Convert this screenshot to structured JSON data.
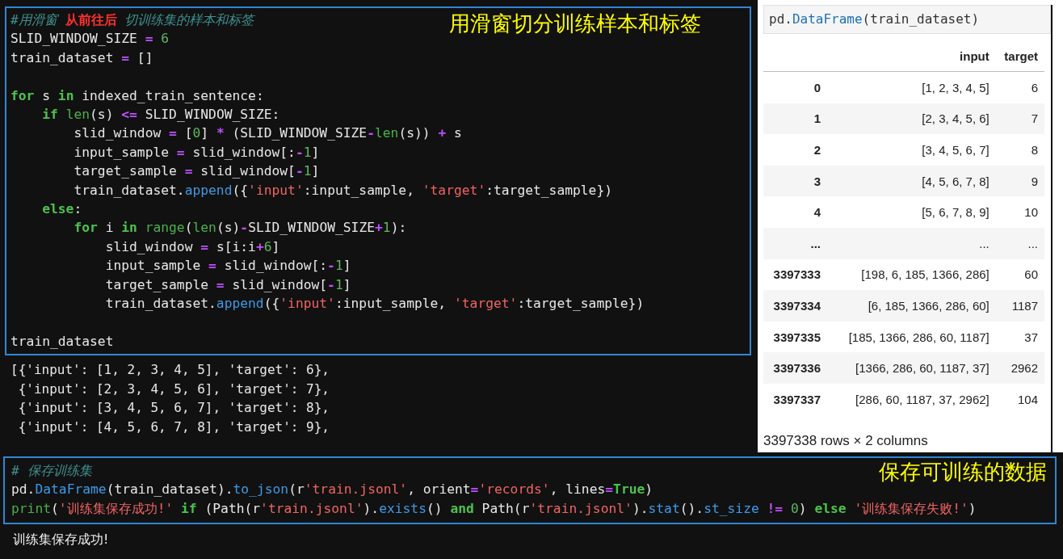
{
  "code_cell": {
    "annotation": "用滑窗切分训练样本和标签",
    "lines": [
      {
        "tokens": [
          {
            "t": "#用滑窗 ",
            "kind": "comment"
          },
          {
            "t": "从前往后",
            "kind": "note"
          },
          {
            "t": " 切训练集的样本和标签",
            "kind": "comment"
          }
        ]
      },
      {
        "tokens": [
          {
            "t": "SLID_WINDOW_SIZE ",
            "kind": "plain"
          },
          {
            "t": "=",
            "kind": "op"
          },
          {
            "t": " 6",
            "kind": "num"
          }
        ]
      },
      {
        "tokens": [
          {
            "t": "train_dataset ",
            "kind": "plain"
          },
          {
            "t": "=",
            "kind": "op"
          },
          {
            "t": " []",
            "kind": "plain"
          }
        ]
      },
      {
        "blank_before": true,
        "tokens": [
          {
            "t": "for",
            "kind": "kw"
          },
          {
            "t": " s ",
            "kind": "plain"
          },
          {
            "t": "in",
            "kind": "kw"
          },
          {
            "t": " indexed_train_sentence:",
            "kind": "plain"
          }
        ]
      },
      {
        "tokens": [
          {
            "t": "    if",
            "kind": "kw"
          },
          {
            "t": " len",
            "kind": "builtin"
          },
          {
            "t": "(s) ",
            "kind": "plain"
          },
          {
            "t": "<=",
            "kind": "op"
          },
          {
            "t": " SLID_WINDOW_SIZE:",
            "kind": "plain"
          }
        ]
      },
      {
        "tokens": [
          {
            "t": "        slid_window ",
            "kind": "plain"
          },
          {
            "t": "=",
            "kind": "op"
          },
          {
            "t": " [",
            "kind": "plain"
          },
          {
            "t": "0",
            "kind": "num"
          },
          {
            "t": "] ",
            "kind": "plain"
          },
          {
            "t": "*",
            "kind": "op"
          },
          {
            "t": " (SLID_WINDOW_SIZE",
            "kind": "plain"
          },
          {
            "t": "-",
            "kind": "op"
          },
          {
            "t": "len",
            "kind": "builtin"
          },
          {
            "t": "(s)) ",
            "kind": "plain"
          },
          {
            "t": "+",
            "kind": "op"
          },
          {
            "t": " s",
            "kind": "plain"
          }
        ]
      },
      {
        "tokens": [
          {
            "t": "        input_sample ",
            "kind": "plain"
          },
          {
            "t": "=",
            "kind": "op"
          },
          {
            "t": " slid_window[:",
            "kind": "plain"
          },
          {
            "t": "-",
            "kind": "op"
          },
          {
            "t": "1",
            "kind": "num"
          },
          {
            "t": "]",
            "kind": "plain"
          }
        ]
      },
      {
        "tokens": [
          {
            "t": "        target_sample ",
            "kind": "plain"
          },
          {
            "t": "=",
            "kind": "op"
          },
          {
            "t": " slid_window[",
            "kind": "plain"
          },
          {
            "t": "-",
            "kind": "op"
          },
          {
            "t": "1",
            "kind": "num"
          },
          {
            "t": "]",
            "kind": "plain"
          }
        ]
      },
      {
        "tokens": [
          {
            "t": "        train_dataset.",
            "kind": "plain"
          },
          {
            "t": "append",
            "kind": "fn"
          },
          {
            "t": "({",
            "kind": "plain"
          },
          {
            "t": "'input'",
            "kind": "str"
          },
          {
            "t": ":input_sample, ",
            "kind": "plain"
          },
          {
            "t": "'target'",
            "kind": "str"
          },
          {
            "t": ":target_sample})",
            "kind": "plain"
          }
        ]
      },
      {
        "tokens": [
          {
            "t": "    else",
            "kind": "kw"
          },
          {
            "t": ":",
            "kind": "plain"
          }
        ]
      },
      {
        "tokens": [
          {
            "t": "        for",
            "kind": "kw"
          },
          {
            "t": " i ",
            "kind": "plain"
          },
          {
            "t": "in",
            "kind": "kw"
          },
          {
            "t": " range",
            "kind": "builtin"
          },
          {
            "t": "(",
            "kind": "plain"
          },
          {
            "t": "len",
            "kind": "builtin"
          },
          {
            "t": "(s)",
            "kind": "plain"
          },
          {
            "t": "-",
            "kind": "op"
          },
          {
            "t": "SLID_WINDOW_SIZE",
            "kind": "plain"
          },
          {
            "t": "+",
            "kind": "op"
          },
          {
            "t": "1",
            "kind": "num"
          },
          {
            "t": "):",
            "kind": "plain"
          }
        ]
      },
      {
        "tokens": [
          {
            "t": "            slid_window ",
            "kind": "plain"
          },
          {
            "t": "=",
            "kind": "op"
          },
          {
            "t": " s[i:i",
            "kind": "plain"
          },
          {
            "t": "+",
            "kind": "op"
          },
          {
            "t": "6",
            "kind": "num"
          },
          {
            "t": "]",
            "kind": "plain"
          }
        ]
      },
      {
        "tokens": [
          {
            "t": "            input_sample ",
            "kind": "plain"
          },
          {
            "t": "=",
            "kind": "op"
          },
          {
            "t": " slid_window[:",
            "kind": "plain"
          },
          {
            "t": "-",
            "kind": "op"
          },
          {
            "t": "1",
            "kind": "num"
          },
          {
            "t": "]",
            "kind": "plain"
          }
        ]
      },
      {
        "tokens": [
          {
            "t": "            target_sample ",
            "kind": "plain"
          },
          {
            "t": "=",
            "kind": "op"
          },
          {
            "t": " slid_window[",
            "kind": "plain"
          },
          {
            "t": "-",
            "kind": "op"
          },
          {
            "t": "1",
            "kind": "num"
          },
          {
            "t": "]",
            "kind": "plain"
          }
        ]
      },
      {
        "tokens": [
          {
            "t": "            train_dataset.",
            "kind": "plain"
          },
          {
            "t": "append",
            "kind": "fn"
          },
          {
            "t": "({",
            "kind": "plain"
          },
          {
            "t": "'input'",
            "kind": "str"
          },
          {
            "t": ":input_sample, ",
            "kind": "plain"
          },
          {
            "t": "'target'",
            "kind": "str"
          },
          {
            "t": ":target_sample})",
            "kind": "plain"
          }
        ]
      },
      {
        "blank_before": true,
        "tokens": [
          {
            "t": "train_dataset",
            "kind": "plain"
          }
        ]
      }
    ]
  },
  "output": [
    "[{'input': [1, 2, 3, 4, 5], 'target': 6},",
    " {'input': [2, 3, 4, 5, 6], 'target': 7},",
    " {'input': [3, 4, 5, 6, 7], 'target': 8},",
    " {'input': [4, 5, 6, 7, 8], 'target': 9},"
  ],
  "dataframe": {
    "code": [
      {
        "t": "pd.",
        "kind": "plain"
      },
      {
        "t": "DataFrame",
        "kind": "fn"
      },
      {
        "t": "(train_dataset)",
        "kind": "plain"
      }
    ],
    "columns": [
      "input",
      "target"
    ],
    "rows": [
      {
        "index": "0",
        "input": "[1, 2, 3, 4, 5]",
        "target": "6"
      },
      {
        "index": "1",
        "input": "[2, 3, 4, 5, 6]",
        "target": "7"
      },
      {
        "index": "2",
        "input": "[3, 4, 5, 6, 7]",
        "target": "8"
      },
      {
        "index": "3",
        "input": "[4, 5, 6, 7, 8]",
        "target": "9"
      },
      {
        "index": "4",
        "input": "[5, 6, 7, 8, 9]",
        "target": "10"
      },
      {
        "index": "...",
        "input": "...",
        "target": "..."
      },
      {
        "index": "3397333",
        "input": "[198, 6, 185, 1366, 286]",
        "target": "60"
      },
      {
        "index": "3397334",
        "input": "[6, 185, 1366, 286, 60]",
        "target": "1187"
      },
      {
        "index": "3397335",
        "input": "[185, 1366, 286, 60, 1187]",
        "target": "37"
      },
      {
        "index": "3397336",
        "input": "[1366, 286, 60, 1187, 37]",
        "target": "2962"
      },
      {
        "index": "3397337",
        "input": "[286, 60, 1187, 37, 2962]",
        "target": "104"
      }
    ],
    "summary": "3397338 rows × 2 columns"
  },
  "save_cell": {
    "annotation": "保存可训练的数据",
    "lines": [
      {
        "tokens": [
          {
            "t": "# 保存训练集",
            "kind": "comment"
          }
        ]
      },
      {
        "tokens": [
          {
            "t": "pd.",
            "kind": "plain"
          },
          {
            "t": "DataFrame",
            "kind": "fn"
          },
          {
            "t": "(train_dataset).",
            "kind": "plain"
          },
          {
            "t": "to_json",
            "kind": "fn"
          },
          {
            "t": "(r",
            "kind": "plain"
          },
          {
            "t": "'train.jsonl'",
            "kind": "str"
          },
          {
            "t": ", orient",
            "kind": "plain"
          },
          {
            "t": "=",
            "kind": "op"
          },
          {
            "t": "'records'",
            "kind": "str"
          },
          {
            "t": ", lines",
            "kind": "plain"
          },
          {
            "t": "=",
            "kind": "op"
          },
          {
            "t": "True",
            "kind": "kw"
          },
          {
            "t": ")",
            "kind": "plain"
          }
        ]
      },
      {
        "tokens": [
          {
            "t": "print",
            "kind": "builtin"
          },
          {
            "t": "(",
            "kind": "plain"
          },
          {
            "t": "'训练集保存成功!'",
            "kind": "str"
          },
          {
            "t": " if",
            "kind": "kw"
          },
          {
            "t": " (Path(r",
            "kind": "plain"
          },
          {
            "t": "'train.jsonl'",
            "kind": "str"
          },
          {
            "t": ").",
            "kind": "plain"
          },
          {
            "t": "exists",
            "kind": "fn"
          },
          {
            "t": "() ",
            "kind": "plain"
          },
          {
            "t": "and",
            "kind": "kw"
          },
          {
            "t": " Path(r",
            "kind": "plain"
          },
          {
            "t": "'train.jsonl'",
            "kind": "str"
          },
          {
            "t": ").",
            "kind": "plain"
          },
          {
            "t": "stat",
            "kind": "fn"
          },
          {
            "t": "().",
            "kind": "plain"
          },
          {
            "t": "st_size",
            "kind": "fn"
          },
          {
            "t": " !=",
            "kind": "op"
          },
          {
            "t": " 0",
            "kind": "num"
          },
          {
            "t": ") ",
            "kind": "plain"
          },
          {
            "t": "else",
            "kind": "kw"
          },
          {
            "t": " '训练集保存失败!'",
            "kind": "str"
          },
          {
            "t": ")",
            "kind": "plain"
          }
        ]
      }
    ]
  },
  "save_output": "训练集保存成功!"
}
